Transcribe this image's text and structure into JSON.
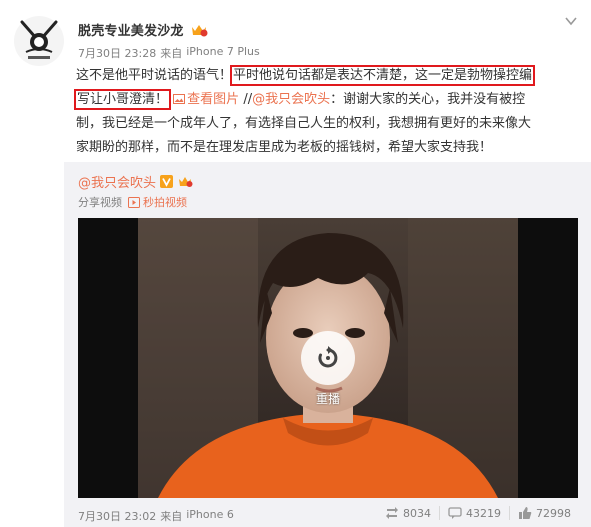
{
  "post": {
    "author": "脱壳专业美发沙龙",
    "time": "7月30日 23:28",
    "via_label": "来自",
    "device": "iPhone 7 Plus",
    "text_line1_a": "这不是他平时说话的语气！",
    "text_line1_b": "平时他说句话都是表达不清楚，这一定是勃物操控编",
    "text_line2_a": "写让小哥澄清！",
    "view_image": "查看图片",
    "sep": "//",
    "mention": "@我只会吹头",
    "text_line2_b": "：谢谢大家的关心，我并没有被控",
    "text_line3": "制，我已经是一个成年人了，有选择自己人生的权利，我想拥有更好的未来像大",
    "text_line4": "家期盼的那样，而不是在理发店里成为老板的摇钱树，希望大家支持我！"
  },
  "repost": {
    "author": "@我只会吹头",
    "share_label": "分享视频",
    "tag_label": "秒拍视频",
    "replay_label": "重播",
    "time": "7月30日 23:02",
    "via_label": "来自",
    "device": "iPhone 6",
    "stats": {
      "reposts": "8034",
      "comments": "43219",
      "likes": "72998"
    }
  },
  "colors": {
    "link": "#eb7350",
    "highlight_box": "#e0191d",
    "repost_bg": "#f2f2f5",
    "meta": "#808080"
  },
  "icons": [
    "chevron-down-icon",
    "vip-badge-icon",
    "image-icon",
    "video-tag-icon",
    "replay-icon",
    "repost-icon",
    "comment-icon",
    "like-icon"
  ]
}
